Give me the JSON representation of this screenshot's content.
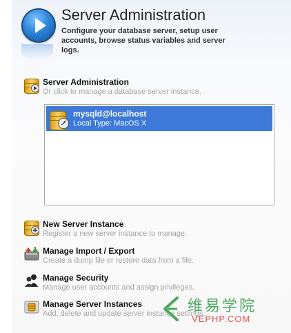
{
  "header": {
    "title": "Server Administration",
    "subtitle": "Configure your database server, setup user accounts, browse status variables and server logs."
  },
  "server_admin": {
    "title": "Server Administration",
    "desc": "Or click to manage a database server instance."
  },
  "instances": [
    {
      "name": "mysqld@localhost",
      "details": "Local  Type: MacOS X"
    }
  ],
  "actions": [
    {
      "title": "New Server Instance",
      "desc": "Register a new server instance to manage.",
      "icon": "new-server-instance-icon"
    },
    {
      "title": "Manage Import / Export",
      "desc": "Create a dump file or restore data from a file.",
      "icon": "import-export-icon"
    },
    {
      "title": "Manage Security",
      "desc": "Manage user accounts and assign privileges.",
      "icon": "security-icon"
    },
    {
      "title": "Manage Server Instances",
      "desc": "Add, delete and update server instance settings.",
      "icon": "server-instances-icon"
    }
  ],
  "watermark": {
    "text_cn": "维易学院",
    "text_en": "VEPHP.COM"
  }
}
